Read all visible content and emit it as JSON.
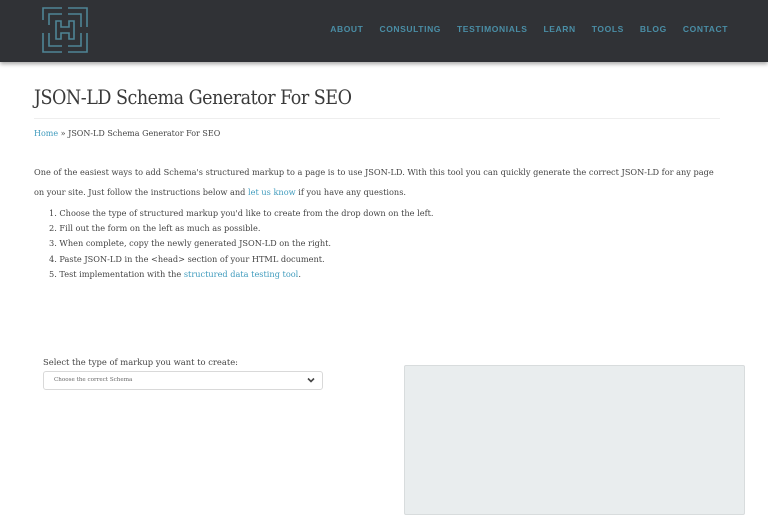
{
  "header": {
    "logo": "h-maze-logo",
    "nav": [
      "ABOUT",
      "CONSULTING",
      "TESTIMONIALS",
      "LEARN",
      "TOOLS",
      "BLOG",
      "CONTACT"
    ]
  },
  "page": {
    "title": "JSON-LD Schema Generator For SEO",
    "breadcrumb": {
      "home": "Home",
      "separator": " » ",
      "current": "JSON-LD Schema Generator For SEO"
    },
    "intro": {
      "part1": "One of the easiest ways to add Schema's structured markup to a page is to use JSON-LD. With this tool you can quickly generate the correct JSON-LD for any page on your site. Just follow the instructions below and ",
      "link": "let us know",
      "part2": " if you have any questions."
    },
    "steps": [
      "1. Choose the type of structured markup you'd like to create from the drop down on the left.",
      "2. Fill out the form on the left as much as possible.",
      "3. When complete, copy the newly generated JSON-LD on the right.",
      "4. Paste JSON-LD in the <head> section of your HTML document."
    ],
    "step5": {
      "prefix": "5. Test implementation with the ",
      "link": "structured data testing tool",
      "suffix": "."
    }
  },
  "generator": {
    "select_label": "Select the type of markup you want to create:",
    "select_value": "Choose the correct Schema",
    "output_value": ""
  },
  "colors": {
    "header_bg": "#303236",
    "accent": "#4a8ea6",
    "link": "#3f9bbd",
    "output_bg": "#e9edee"
  }
}
